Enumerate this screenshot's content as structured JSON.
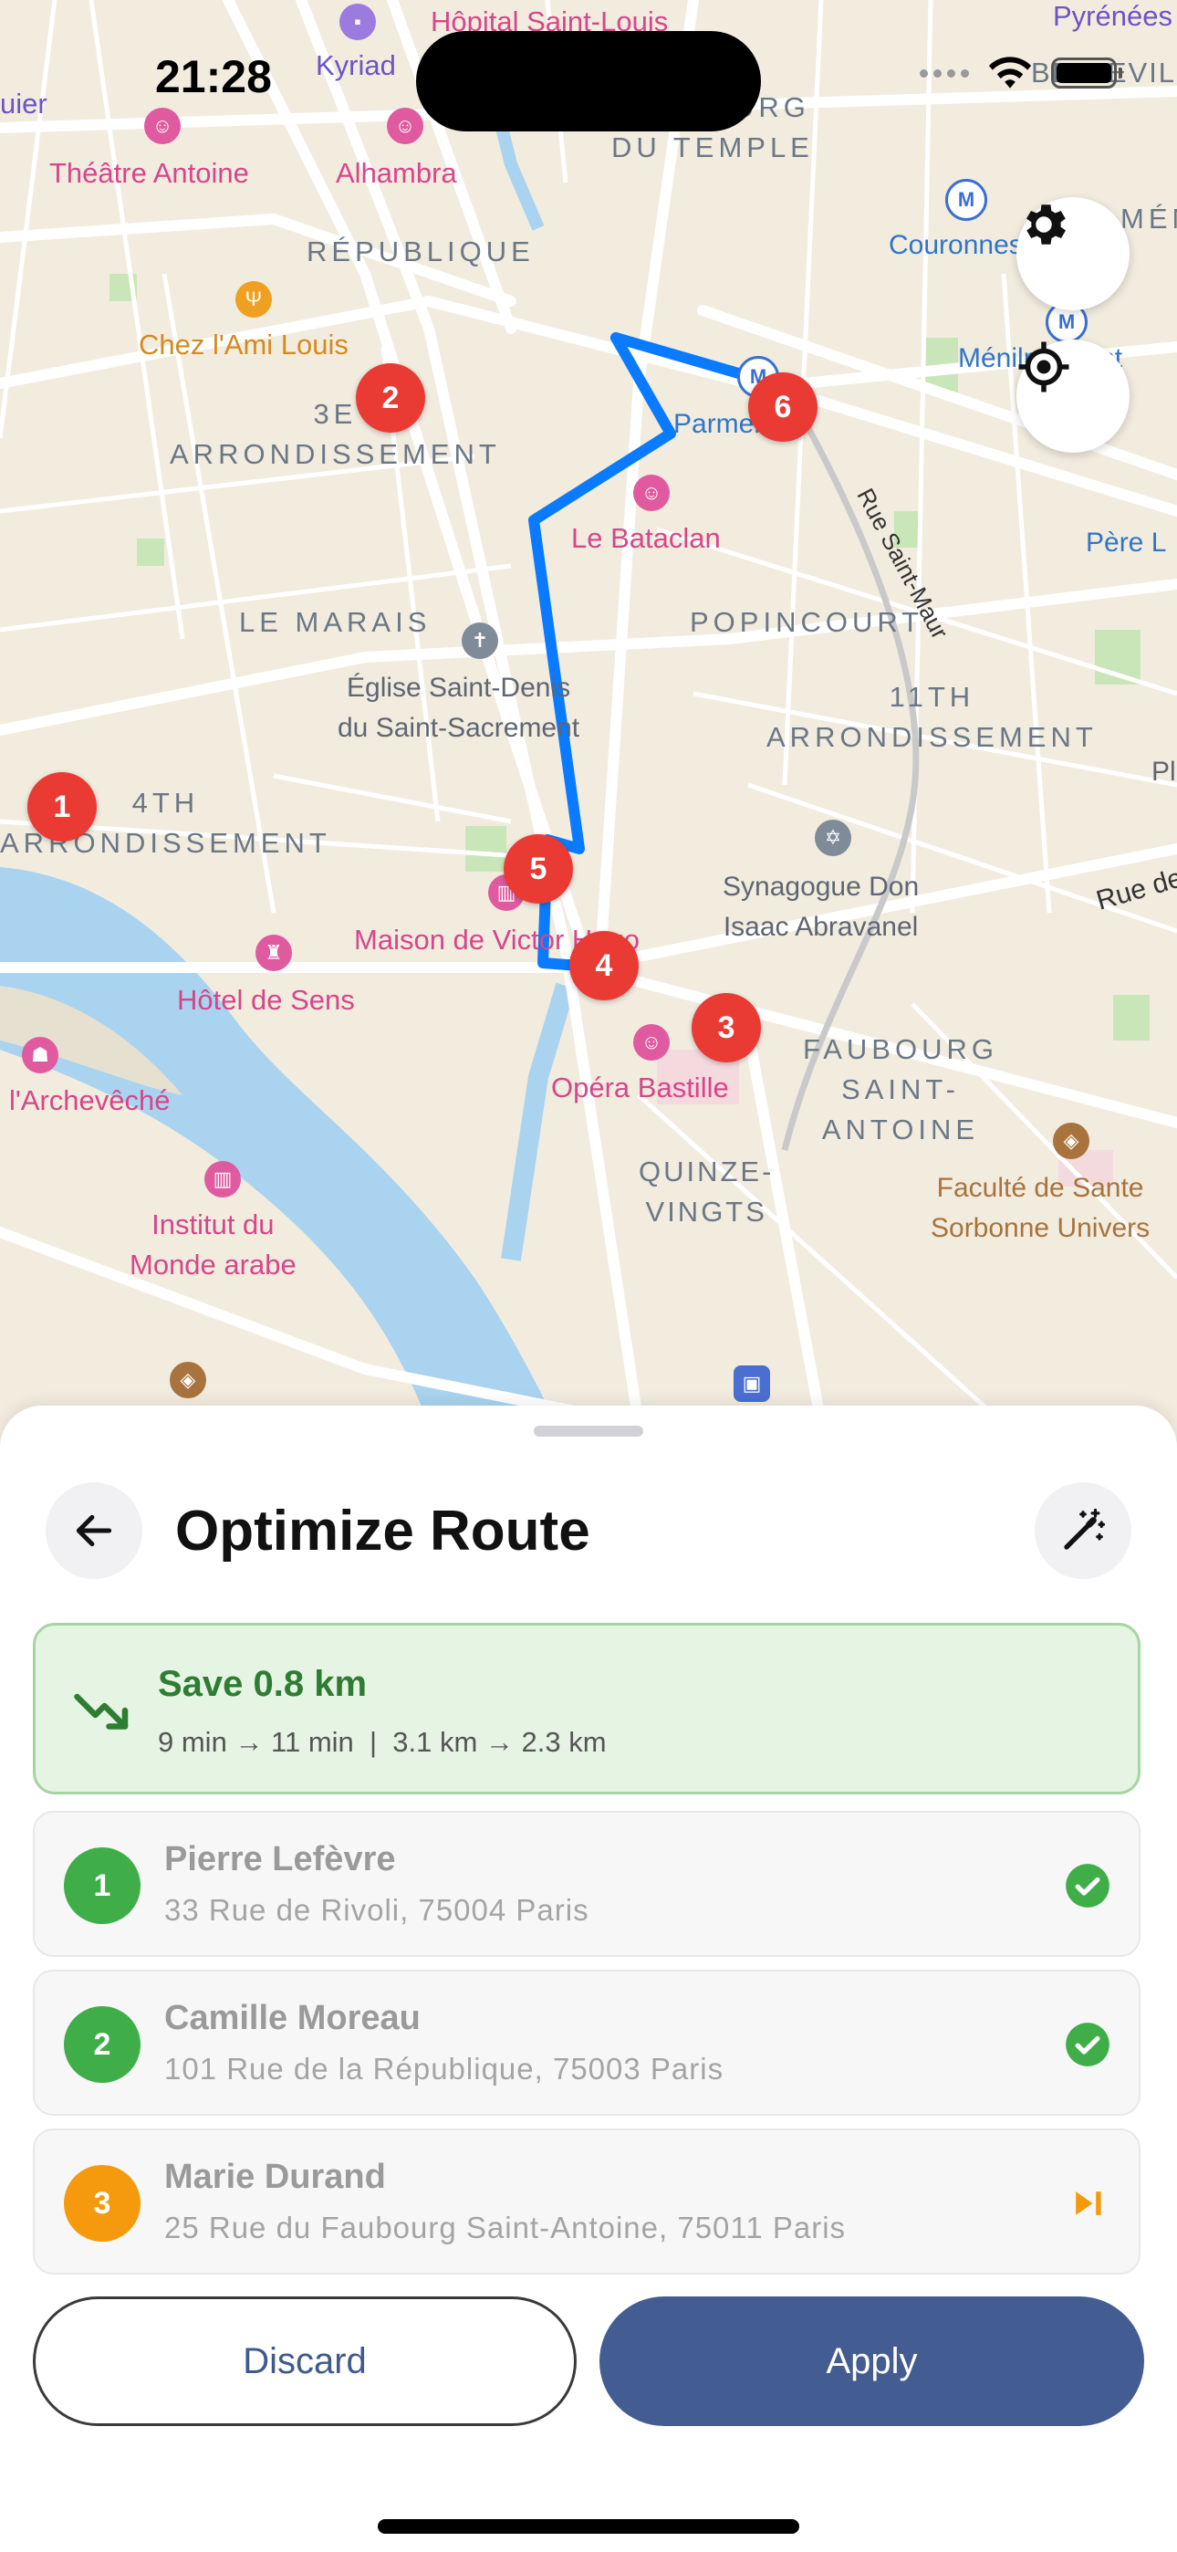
{
  "status_bar": {
    "time": "21:28"
  },
  "map": {
    "labels": {
      "hopital": "Hôpital Saint-Louis",
      "pyrenees": "Pyrénées",
      "belleville": "BELLEVILLE",
      "kyriad": "Kyriad",
      "uier": "uier",
      "theatre_antoine": "Théâtre Antoine",
      "alhambra": "Alhambra",
      "faubourg_temple": "FAUBOURG\nDU TEMPLE",
      "republique": "RÉPUBLIQUE",
      "couronnes": "Couronnes",
      "menilmontant_short": "MÉN",
      "chez_ami_louis": "Chez l'Ami Louis",
      "menilmontant": "Ménilmontant",
      "third_arr": "3E\nARRONDISSEMENT",
      "parmentier": "Parmentier",
      "rue_saint_maur": "Rue Saint-Maur",
      "le_bataclan": "Le Bataclan",
      "pere_l": "Père L",
      "le_marais": "LE MARAIS",
      "popincourt": "POPINCOURT",
      "eglise": "Église Saint-Denis\ndu Saint-Sacrement",
      "eleventh_arr": "11TH\nARRONDISSEMENT",
      "pl": "Pl",
      "fourth_arr": "4TH\nARRONDISSEMENT",
      "synagogue": "Synagogue Don\nIsaac Abravanel",
      "rue_de": "Rue de",
      "maison_victor_hugo": "Maison de Victor Hugo",
      "hotel_de_sens": "Hôtel de Sens",
      "opera_bastille": "Opéra Bastille",
      "faubourg_saint_antoine": "FAUBOURG\nSAINT-\nANTOINE",
      "archeveche": "l'Archevêché",
      "faculte": "Faculté de Sante\nSorbonne Univers",
      "quinze_vingts": "QUINZE-\nVINGTS",
      "institut": "Institut du\nMonde arabe"
    },
    "pins": [
      "1",
      "2",
      "3",
      "4",
      "5",
      "6"
    ],
    "route_color": "#0a7aff",
    "pin_color": "#ea3a34",
    "controls": {
      "settings_icon": "gear-icon",
      "locate_icon": "crosshair-icon"
    }
  },
  "sheet": {
    "title": "Optimize Route",
    "back_icon": "arrow-left-icon",
    "magic_icon": "magic-wand-icon",
    "savings": {
      "title": "Save 0.8 km",
      "detail": "9 min → 11 min  |  3.1 km → 2.3 km",
      "icon": "trending-down-icon",
      "color": "#2e7d32"
    },
    "stops": [
      {
        "number": "1",
        "name": "Pierre Lefèvre",
        "address": "33 Rue de Rivoli, 75004 Paris",
        "status": "done",
        "badge_color": "#3fae49"
      },
      {
        "number": "2",
        "name": "Camille Moreau",
        "address": "101 Rue de la République, 75003 Paris",
        "status": "done",
        "badge_color": "#3fae49"
      },
      {
        "number": "3",
        "name": "Marie Durand",
        "address": "25 Rue du Faubourg Saint-Antoine, 75011 Paris",
        "status": "skip",
        "badge_color": "#f59a0c"
      }
    ],
    "buttons": {
      "discard": "Discard",
      "apply": "Apply"
    }
  }
}
